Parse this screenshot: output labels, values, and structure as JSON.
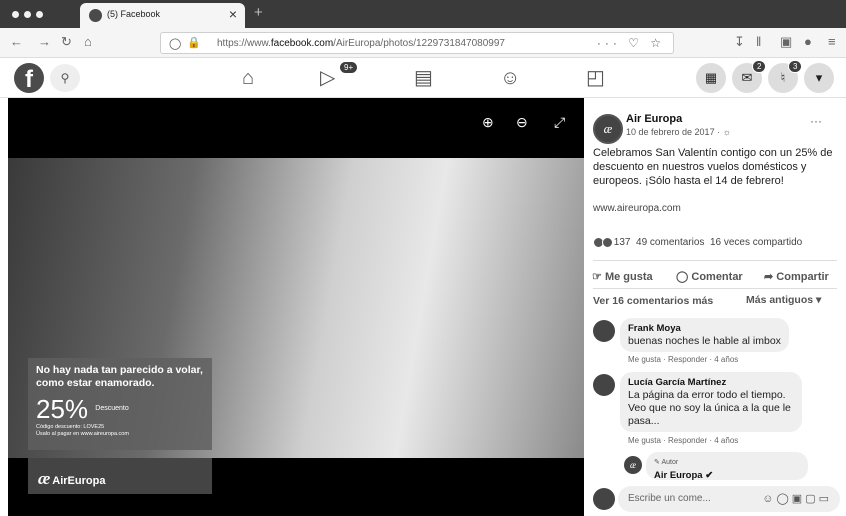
{
  "browser": {
    "tab_title": "(5) Facebook",
    "url_prefix": "https://www.",
    "url_domain": "facebook.com",
    "url_path": "/AirEuropa/photos/1229731847080997",
    "new_tab": "+",
    "close": "×"
  },
  "fb_nav": {
    "watch_badge": "9+",
    "messenger_badge": "2",
    "notifications_badge": "3"
  },
  "photo": {
    "promo_heading": "No hay nada tan parecido a volar, como estar enamorado.",
    "promo_percent": "25%",
    "promo_percent_label": "Descuento",
    "promo_code": "Código descuento: LOVE25",
    "promo_note": "Úsalo al pagar en www.aireuropa.com",
    "brand": "AirEuropa"
  },
  "post": {
    "author": "Air Europa",
    "date": "10 de febrero de 2017 · ",
    "text": "Celebramos San Valentín contigo con un 25% de descuento en nuestros vuelos domésticos y europeos. ¡Sólo hasta el 14 de febrero!",
    "link": "www.aireuropa.com",
    "reaction_count": "137",
    "comments_count": "49 comentarios",
    "shares_count": "16 veces compartido",
    "like_label": "Me gusta",
    "comment_label": "Comentar",
    "share_label": "Compartir"
  },
  "comments": {
    "more_label": "Ver 16 comentarios más",
    "sort_label": "Más antiguos",
    "items": [
      {
        "author": "Frank Moya",
        "text": "buenas noches le hable al imbox",
        "meta": "Me gusta · Responder · 4 años"
      },
      {
        "author": "Lucía García Martínez",
        "text": "La página da error todo el tiempo. Veo que no soy la única a la que le pasa...",
        "meta": "Me gusta · Responder · 4 años"
      }
    ],
    "reply_tag": "Autor",
    "reply_author": "Air Europa",
    "input_placeholder": "Escribe un come..."
  }
}
